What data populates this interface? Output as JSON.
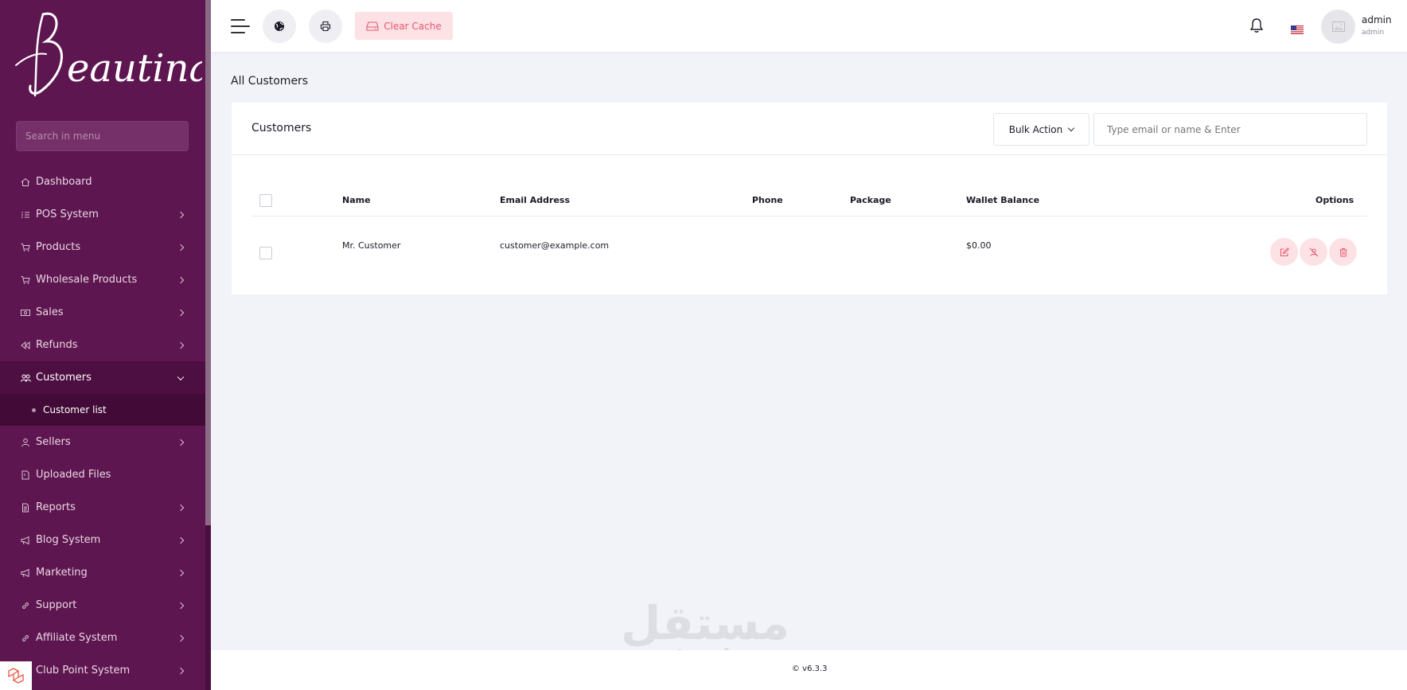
{
  "app": {
    "brand": "Beautina",
    "sidebar_search_placeholder": "Search in menu"
  },
  "sidebar": {
    "items": [
      {
        "label": "Dashboard",
        "icon": "home-icon",
        "has_chevron": false
      },
      {
        "label": "POS System",
        "icon": "list-icon",
        "has_chevron": true
      },
      {
        "label": "Products",
        "icon": "cart-icon",
        "has_chevron": true
      },
      {
        "label": "Wholesale Products",
        "icon": "cart-icon",
        "has_chevron": true
      },
      {
        "label": "Sales",
        "icon": "money-icon",
        "has_chevron": true
      },
      {
        "label": "Refunds",
        "icon": "backward-icon",
        "has_chevron": true
      },
      {
        "label": "Customers",
        "icon": "users-icon",
        "has_chevron": true,
        "active": true
      },
      {
        "label": "Sellers",
        "icon": "user-icon",
        "has_chevron": true
      },
      {
        "label": "Uploaded Files",
        "icon": "folder-icon",
        "has_chevron": false
      },
      {
        "label": "Reports",
        "icon": "file-icon",
        "has_chevron": true
      },
      {
        "label": "Blog System",
        "icon": "bullhorn-icon",
        "has_chevron": true
      },
      {
        "label": "Marketing",
        "icon": "bullhorn-icon",
        "has_chevron": true
      },
      {
        "label": "Support",
        "icon": "link-icon",
        "has_chevron": true
      },
      {
        "label": "Affiliate System",
        "icon": "link-icon",
        "has_chevron": true
      },
      {
        "label": "Club Point System",
        "icon": "club-icon",
        "has_chevron": true
      }
    ],
    "submenu_customer_list": "Customer list"
  },
  "topbar": {
    "clear_cache_label": "Clear Cache",
    "user_name": "admin",
    "user_role": "admin"
  },
  "page": {
    "title": "All Customers"
  },
  "card": {
    "title": "Customers",
    "bulk_action_label": "Bulk Action",
    "search_placeholder": "Type email or name & Enter"
  },
  "table": {
    "headers": {
      "name": "Name",
      "email": "Email Address",
      "phone": "Phone",
      "package": "Package",
      "wallet": "Wallet Balance",
      "options": "Options"
    },
    "rows": [
      {
        "name": "Mr. Customer",
        "email": "customer@example.com",
        "phone": "",
        "package": "",
        "wallet": "$0.00"
      }
    ]
  },
  "footer": {
    "version": "© v6.3.3"
  },
  "watermark": {
    "arabic": "مستقل",
    "latin": "mostaql.com"
  },
  "colors": {
    "sidebar_bg": "#5e1650",
    "sidebar_active": "#4d0f41",
    "accent_pink": "#e8596e",
    "accent_pink_bg": "#fce1e5"
  }
}
